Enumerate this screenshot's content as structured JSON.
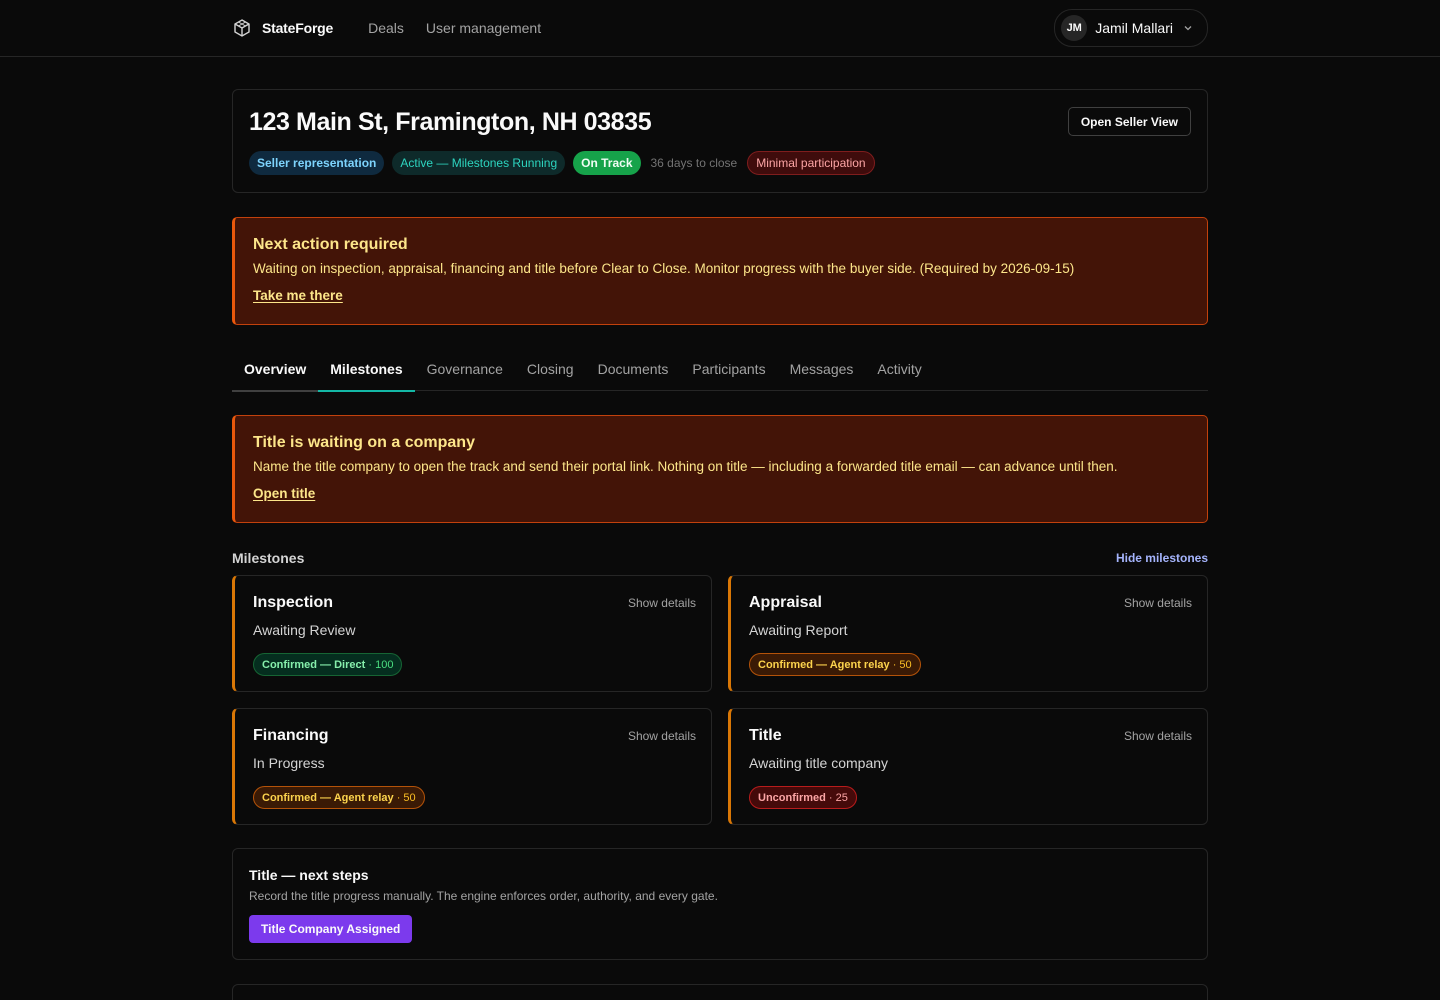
{
  "nav": {
    "brand": "StateForge",
    "links": [
      "Deals",
      "User management"
    ],
    "user": {
      "initials": "JM",
      "name": "Jamil Mallari"
    }
  },
  "deal": {
    "title": "123 Main St, Framington, NH 03835",
    "open_seller_view": "Open Seller View",
    "badges": {
      "representation": "Seller representation",
      "status": "Active — Milestones Running",
      "health": "On Track",
      "days": "36 days to close",
      "participation": "Minimal participation"
    }
  },
  "next_action": {
    "title": "Next action required",
    "text": "Waiting on inspection, appraisal, financing and title before Clear to Close. Monitor progress with the buyer side. (Required by 2026-09-15)",
    "link": "Take me there"
  },
  "tabs": [
    "Overview",
    "Milestones",
    "Governance",
    "Closing",
    "Documents",
    "Participants",
    "Messages",
    "Activity"
  ],
  "title_alert": {
    "title": "Title is waiting on a company",
    "text": "Name the title company to open the track and send their portal link. Nothing on title — including a forwarded title email — can advance until then.",
    "link": "Open title"
  },
  "milestones": {
    "label": "Milestones",
    "hide": "Hide milestones",
    "show_details": "Show details",
    "items": [
      {
        "title": "Inspection",
        "status": "Awaiting Review",
        "badge": "Confirmed — Direct",
        "points": "· 100",
        "tone": "green"
      },
      {
        "title": "Appraisal",
        "status": "Awaiting Report",
        "badge": "Confirmed — Agent relay",
        "points": "· 50",
        "tone": "amber"
      },
      {
        "title": "Financing",
        "status": "In Progress",
        "badge": "Confirmed — Agent relay",
        "points": "· 50",
        "tone": "amber"
      },
      {
        "title": "Title",
        "status": "Awaiting title company",
        "badge": "Unconfirmed",
        "points": "· 25",
        "tone": "red"
      }
    ]
  },
  "next_steps": {
    "title": "Title — next steps",
    "text": "Record the title progress manually. The engine enforces order, authority, and every gate.",
    "button": "Title Company Assigned"
  }
}
